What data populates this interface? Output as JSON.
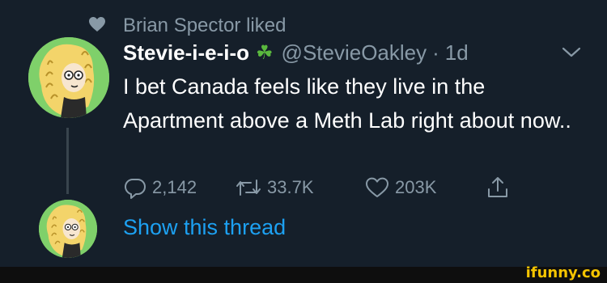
{
  "social_context": {
    "text": "Brian Spector liked",
    "icon": "heart-icon"
  },
  "tweet": {
    "display_name": "Stevie-i-e-i-o",
    "name_emoji": "☘",
    "handle": "@StevieOakley",
    "separator": "·",
    "time": "1d",
    "text": "I bet Canada feels like they live in the Apartment above a Meth Lab right about now..",
    "actions": {
      "reply_count": "2,142",
      "retweet_count": "33.7K",
      "like_count": "203K"
    },
    "show_thread_label": "Show this thread"
  },
  "watermark": "ifunny.co",
  "colors": {
    "background": "#151f2a",
    "secondary_text": "#8899a6",
    "link": "#1da1f2",
    "clover": "#5ab93e",
    "watermark": "#f5c400"
  }
}
